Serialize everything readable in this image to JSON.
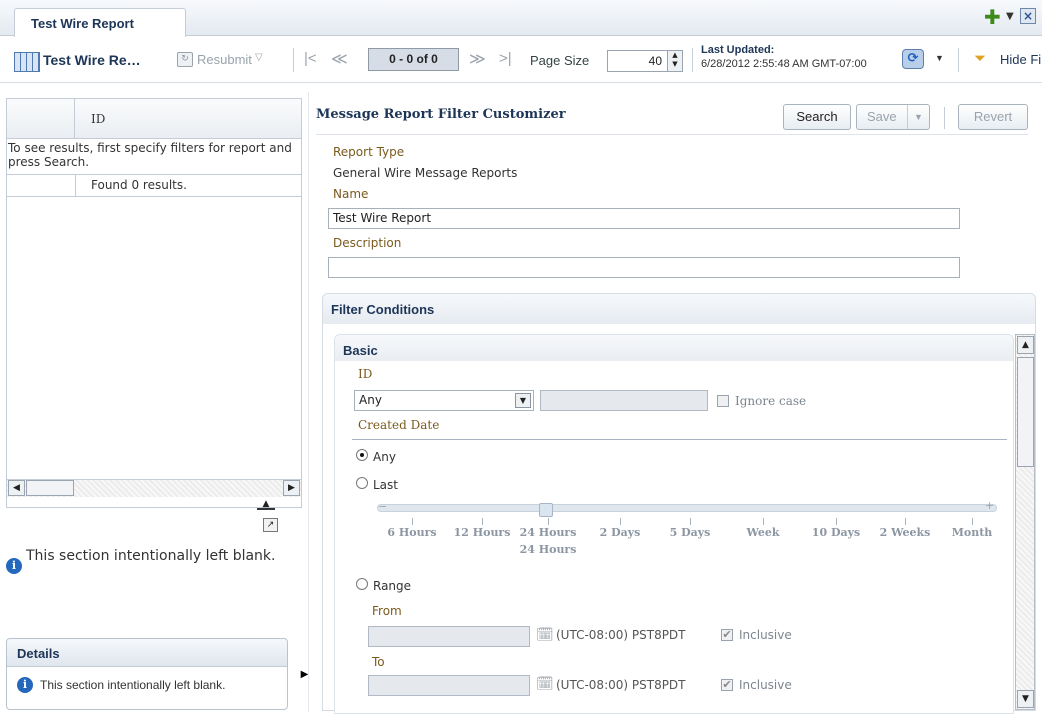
{
  "tab": {
    "title": "Test Wire Report",
    "add_icon": "plus-icon",
    "menu_icon": "chevron-down-icon",
    "close_icon": "close-icon"
  },
  "toolbar": {
    "report_name": "Test Wire Re…",
    "resubmit_label": "Resubmit",
    "pager_text": "0 - 0 of 0",
    "page_size_label": "Page Size",
    "page_size_value": "40",
    "last_updated_label": "Last Updated:",
    "last_updated_value": "6/28/2012 2:55:48 AM GMT-07:00",
    "hide_label": "Hide Fi"
  },
  "left_table": {
    "column_id": "ID",
    "instructions": "To see results, first specify filters for report and press Search.",
    "found_text": "Found 0 results."
  },
  "left_blank_text": "This section intentionally left blank.",
  "details": {
    "title": "Details",
    "text": "This section intentionally left blank."
  },
  "customizer": {
    "title": "Message Report Filter Customizer",
    "search_label": "Search",
    "save_label": "Save",
    "revert_label": "Revert",
    "report_type_label": "Report Type",
    "report_type_value": "General Wire Message Reports",
    "name_label": "Name",
    "name_value": "Test Wire Report",
    "description_label": "Description",
    "description_value": ""
  },
  "filters": {
    "title": "Filter Conditions",
    "basic_title": "Basic",
    "id_label": "ID",
    "id_operator": "Any",
    "ignore_case_label": "Ignore case",
    "created_date_label": "Created Date",
    "any_label": "Any",
    "last_label": "Last",
    "slider_ticks": [
      "6 Hours",
      "12 Hours",
      "24 Hours",
      "2 Days",
      "5 Days",
      "Week",
      "10 Days",
      "2 Weeks",
      "Month"
    ],
    "slider_value": "24 Hours",
    "range_label": "Range",
    "from_label": "From",
    "to_label": "To",
    "timezone": "(UTC-08:00) PST8PDT",
    "inclusive_label": "Inclusive",
    "selected_date_option": "Any"
  }
}
